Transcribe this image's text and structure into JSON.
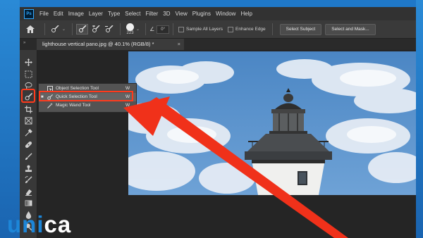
{
  "menubar": {
    "items": [
      "File",
      "Edit",
      "Image",
      "Layer",
      "Type",
      "Select",
      "Filter",
      "3D",
      "View",
      "Plugins",
      "Window",
      "Help"
    ]
  },
  "options": {
    "brush_size": "223",
    "angle": "0°",
    "sample_all_layers": "Sample All Layers",
    "enhance_edge": "Enhance Edge",
    "select_subject": "Select Subject",
    "select_and_mask": "Select and Mask..."
  },
  "document": {
    "tab_title": "lighthouse vertical pano.jpg @ 40.1% (RGB/8) *",
    "close": "×"
  },
  "flyout": {
    "items": [
      {
        "label": "Object Selection Tool",
        "key": "W"
      },
      {
        "label": "Quick Selection Tool",
        "key": "W"
      },
      {
        "label": "Magic Wand Tool",
        "key": "W"
      }
    ]
  },
  "logo": {
    "text_left": "u",
    "text_blue": "ni",
    "text_right": "ca"
  },
  "colors": {
    "highlight": "#ff3a1c",
    "arrow": "#f0311a",
    "logo_blue": "#1d86d8"
  }
}
